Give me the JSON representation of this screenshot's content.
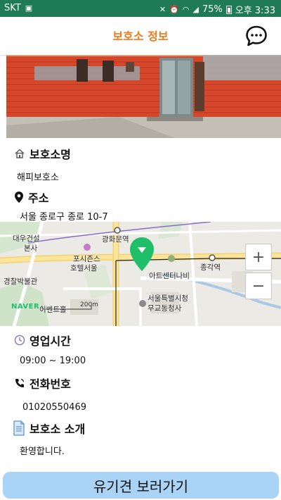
{
  "status_bar": {
    "carrier": "SKT",
    "battery": "75%",
    "time": "오후 3:33"
  },
  "header": {
    "title": "보호소 정보"
  },
  "sections": {
    "shelter_name": {
      "label": "보호소명",
      "value": "해피보호소"
    },
    "address": {
      "label": "주소",
      "value": "서울 종로구 종로 10-7"
    },
    "hours": {
      "label": "영업시간",
      "value": "09:00 ~ 19:00"
    },
    "phone": {
      "label": "전화번호",
      "value": "01020550469"
    },
    "intro": {
      "label": "보호소 소개",
      "value": "환영합니다."
    }
  },
  "map": {
    "zoom_in": "+",
    "zoom_out": "−",
    "scale": "200m",
    "provider": "NAVER",
    "labels": {
      "daewoo": "대우건설",
      "daewoo2": "본사",
      "gwanghwamun": "광화문역",
      "four_seasons": "포시즌스",
      "four_seasons2": "호텔서울",
      "art_center": "아트센터나비",
      "jonggak": "종각역",
      "museum": "경찰박물관",
      "event_hall": "이벤트홀",
      "city_hall": "서울특별시청",
      "mugyo": "무교동청사"
    },
    "marker_color": "#1fbf6a"
  },
  "cta": {
    "label": "유기견 보러가기"
  },
  "colors": {
    "status_bar": "#1f7a56",
    "title": "#f07a1a",
    "cta": "#aad4f6"
  }
}
